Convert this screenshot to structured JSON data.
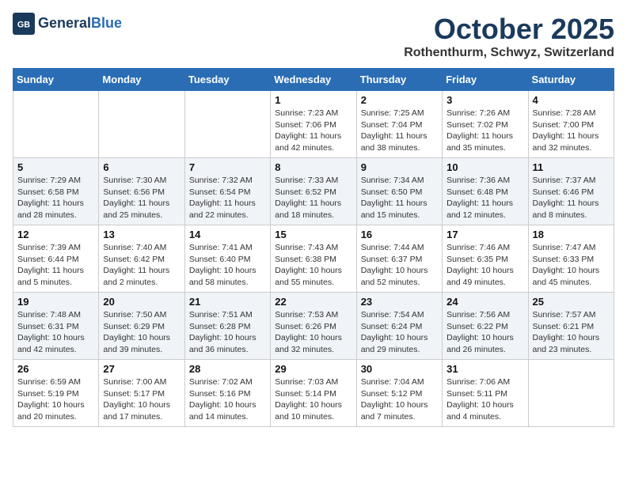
{
  "header": {
    "logo_line1": "General",
    "logo_line2": "Blue",
    "month": "October 2025",
    "location": "Rothenthurm, Schwyz, Switzerland"
  },
  "days_of_week": [
    "Sunday",
    "Monday",
    "Tuesday",
    "Wednesday",
    "Thursday",
    "Friday",
    "Saturday"
  ],
  "weeks": [
    [
      {
        "day": "",
        "info": ""
      },
      {
        "day": "",
        "info": ""
      },
      {
        "day": "",
        "info": ""
      },
      {
        "day": "1",
        "info": "Sunrise: 7:23 AM\nSunset: 7:06 PM\nDaylight: 11 hours and 42 minutes."
      },
      {
        "day": "2",
        "info": "Sunrise: 7:25 AM\nSunset: 7:04 PM\nDaylight: 11 hours and 38 minutes."
      },
      {
        "day": "3",
        "info": "Sunrise: 7:26 AM\nSunset: 7:02 PM\nDaylight: 11 hours and 35 minutes."
      },
      {
        "day": "4",
        "info": "Sunrise: 7:28 AM\nSunset: 7:00 PM\nDaylight: 11 hours and 32 minutes."
      }
    ],
    [
      {
        "day": "5",
        "info": "Sunrise: 7:29 AM\nSunset: 6:58 PM\nDaylight: 11 hours and 28 minutes."
      },
      {
        "day": "6",
        "info": "Sunrise: 7:30 AM\nSunset: 6:56 PM\nDaylight: 11 hours and 25 minutes."
      },
      {
        "day": "7",
        "info": "Sunrise: 7:32 AM\nSunset: 6:54 PM\nDaylight: 11 hours and 22 minutes."
      },
      {
        "day": "8",
        "info": "Sunrise: 7:33 AM\nSunset: 6:52 PM\nDaylight: 11 hours and 18 minutes."
      },
      {
        "day": "9",
        "info": "Sunrise: 7:34 AM\nSunset: 6:50 PM\nDaylight: 11 hours and 15 minutes."
      },
      {
        "day": "10",
        "info": "Sunrise: 7:36 AM\nSunset: 6:48 PM\nDaylight: 11 hours and 12 minutes."
      },
      {
        "day": "11",
        "info": "Sunrise: 7:37 AM\nSunset: 6:46 PM\nDaylight: 11 hours and 8 minutes."
      }
    ],
    [
      {
        "day": "12",
        "info": "Sunrise: 7:39 AM\nSunset: 6:44 PM\nDaylight: 11 hours and 5 minutes."
      },
      {
        "day": "13",
        "info": "Sunrise: 7:40 AM\nSunset: 6:42 PM\nDaylight: 11 hours and 2 minutes."
      },
      {
        "day": "14",
        "info": "Sunrise: 7:41 AM\nSunset: 6:40 PM\nDaylight: 10 hours and 58 minutes."
      },
      {
        "day": "15",
        "info": "Sunrise: 7:43 AM\nSunset: 6:38 PM\nDaylight: 10 hours and 55 minutes."
      },
      {
        "day": "16",
        "info": "Sunrise: 7:44 AM\nSunset: 6:37 PM\nDaylight: 10 hours and 52 minutes."
      },
      {
        "day": "17",
        "info": "Sunrise: 7:46 AM\nSunset: 6:35 PM\nDaylight: 10 hours and 49 minutes."
      },
      {
        "day": "18",
        "info": "Sunrise: 7:47 AM\nSunset: 6:33 PM\nDaylight: 10 hours and 45 minutes."
      }
    ],
    [
      {
        "day": "19",
        "info": "Sunrise: 7:48 AM\nSunset: 6:31 PM\nDaylight: 10 hours and 42 minutes."
      },
      {
        "day": "20",
        "info": "Sunrise: 7:50 AM\nSunset: 6:29 PM\nDaylight: 10 hours and 39 minutes."
      },
      {
        "day": "21",
        "info": "Sunrise: 7:51 AM\nSunset: 6:28 PM\nDaylight: 10 hours and 36 minutes."
      },
      {
        "day": "22",
        "info": "Sunrise: 7:53 AM\nSunset: 6:26 PM\nDaylight: 10 hours and 32 minutes."
      },
      {
        "day": "23",
        "info": "Sunrise: 7:54 AM\nSunset: 6:24 PM\nDaylight: 10 hours and 29 minutes."
      },
      {
        "day": "24",
        "info": "Sunrise: 7:56 AM\nSunset: 6:22 PM\nDaylight: 10 hours and 26 minutes."
      },
      {
        "day": "25",
        "info": "Sunrise: 7:57 AM\nSunset: 6:21 PM\nDaylight: 10 hours and 23 minutes."
      }
    ],
    [
      {
        "day": "26",
        "info": "Sunrise: 6:59 AM\nSunset: 5:19 PM\nDaylight: 10 hours and 20 minutes."
      },
      {
        "day": "27",
        "info": "Sunrise: 7:00 AM\nSunset: 5:17 PM\nDaylight: 10 hours and 17 minutes."
      },
      {
        "day": "28",
        "info": "Sunrise: 7:02 AM\nSunset: 5:16 PM\nDaylight: 10 hours and 14 minutes."
      },
      {
        "day": "29",
        "info": "Sunrise: 7:03 AM\nSunset: 5:14 PM\nDaylight: 10 hours and 10 minutes."
      },
      {
        "day": "30",
        "info": "Sunrise: 7:04 AM\nSunset: 5:12 PM\nDaylight: 10 hours and 7 minutes."
      },
      {
        "day": "31",
        "info": "Sunrise: 7:06 AM\nSunset: 5:11 PM\nDaylight: 10 hours and 4 minutes."
      },
      {
        "day": "",
        "info": ""
      }
    ]
  ]
}
